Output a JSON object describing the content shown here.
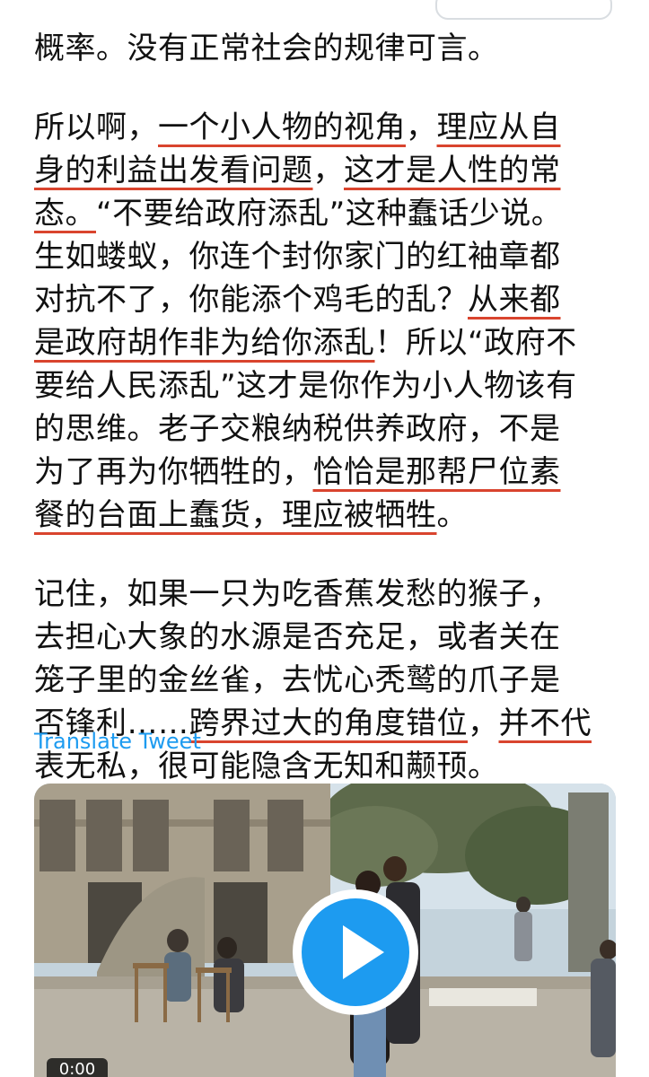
{
  "tweet": {
    "paragraphs": [
      [
        [
          {
            "t": "概率。没有正常社会的规律可言。",
            "h": false
          }
        ]
      ],
      [
        [
          {
            "t": "所以啊，",
            "h": false
          },
          {
            "t": "一个小人物的视角",
            "h": true
          },
          {
            "t": "，",
            "h": false
          },
          {
            "t": "理应从自",
            "h": true
          }
        ],
        [
          {
            "t": "身的利益出发看问题",
            "h": true
          },
          {
            "t": "，",
            "h": false
          },
          {
            "t": "这才是人性的常",
            "h": true
          }
        ],
        [
          {
            "t": "态。",
            "h": true
          },
          {
            "t": "“不要给政府添乱”这种蠢话少说。",
            "h": false
          }
        ],
        [
          {
            "t": "生如蝼蚁，你连个封你家门的红袖章都",
            "h": false
          }
        ],
        [
          {
            "t": "对抗不了，你能添个鸡毛的乱？",
            "h": false
          },
          {
            "t": "从来都",
            "h": true
          }
        ],
        [
          {
            "t": "是政府胡作非为给你添乱",
            "h": true
          },
          {
            "t": "！所以“政府不",
            "h": false
          }
        ],
        [
          {
            "t": "要给人民添乱”这才是你作为小人物该有",
            "h": false
          }
        ],
        [
          {
            "t": "的思维。老子交粮纳税供养政府，不是",
            "h": false
          }
        ],
        [
          {
            "t": "为了再为你牺牲的，",
            "h": false
          },
          {
            "t": "恰恰是那帮尸位素",
            "h": true
          }
        ],
        [
          {
            "t": "餐的台面上蠢货，理应被牺牲",
            "h": true
          },
          {
            "t": "。",
            "h": false
          }
        ]
      ],
      [
        [
          {
            "t": "记住，如果一只为吃香蕉发愁的猴子，",
            "h": false
          }
        ],
        [
          {
            "t": "去担心大象的水源是否充足，或者关在",
            "h": false
          }
        ],
        [
          {
            "t": "笼子里的金丝雀，去忧心秃鹫的爪子是",
            "h": false
          }
        ],
        [
          {
            "t": "否锋利……",
            "h": false
          },
          {
            "t": "跨界过大的角度错位",
            "h": true
          },
          {
            "t": "，",
            "h": false
          },
          {
            "t": "并不代",
            "h": true
          }
        ],
        [
          {
            "t": "表无私，",
            "h": false
          },
          {
            "t": "很可能隐含无知和颟顸。",
            "h": true
          }
        ]
      ]
    ],
    "translate_label": "Translate Tweet"
  },
  "media": {
    "type": "video",
    "duration_label": "0:00",
    "play_icon": "play-icon"
  },
  "colors": {
    "highlight_underline": "#d9442e",
    "link": "#1d9bf0",
    "play_circle": "#1d9bf0"
  }
}
